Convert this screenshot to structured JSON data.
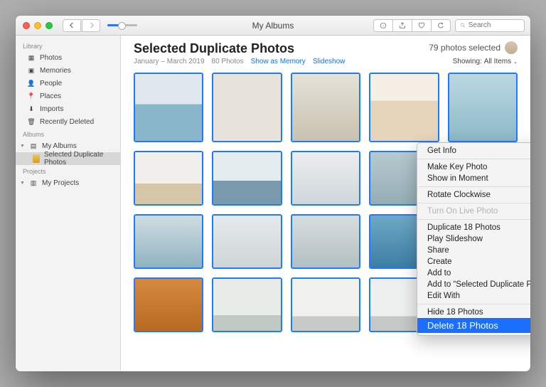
{
  "titlebar": {
    "title": "My Albums"
  },
  "search": {
    "placeholder": "Search"
  },
  "sidebar": {
    "sections": {
      "library": "Library",
      "albums": "Albums",
      "projects": "Projects"
    },
    "library": {
      "photos": "Photos",
      "memories": "Memories",
      "people": "People",
      "places": "Places",
      "imports": "Imports",
      "recently_deleted": "Recently Deleted"
    },
    "albums": {
      "my_albums": "My Albums",
      "selected_duplicate_photos": "Selected Duplicate Photos"
    },
    "projects": {
      "my_projects": "My Projects"
    }
  },
  "header": {
    "title": "Selected Duplicate Photos",
    "selected_count": "79 photos selected"
  },
  "subheader": {
    "date_range": "January – March 2019",
    "photo_count": "80 Photos",
    "show_as_memory": "Show as Memory",
    "slideshow": "Slideshow",
    "showing_label": "Showing:",
    "showing_value": "All Items"
  },
  "context_menu": {
    "get_info": "Get Info",
    "make_key_photo": "Make Key Photo",
    "show_in_moment": "Show in Moment",
    "rotate_clockwise": "Rotate Clockwise",
    "turn_on_live_photo": "Turn On Live Photo",
    "duplicate": "Duplicate 18 Photos",
    "play_slideshow": "Play Slideshow",
    "share": "Share",
    "create": "Create",
    "add_to": "Add to",
    "add_to_album": "Add to “Selected Duplicate Photos”",
    "edit_with": "Edit With",
    "hide": "Hide 18 Photos",
    "delete": "Delete 18 Photos"
  },
  "thumbs": {
    "r0": [
      "linear-gradient(#dfe8ed 0 45%, #8ab6cb 45% 100%)",
      "linear-gradient(#e7e3da 0 100%)",
      "linear-gradient(#e5e2d8,#c8c2b0)",
      "linear-gradient(#f5efe5 0 40%, #e6d5bb 40% 100%)",
      "linear-gradient(#bcd8e1,#8cb9c8)"
    ],
    "r1": [
      "linear-gradient(#f0efec 0 60%, #d6c6a8 60% 100%)",
      "linear-gradient(#e4ecf0 0 55%, #7a9bad 55% 100%)",
      "linear-gradient(#eceff1,#d0d6da)",
      "linear-gradient(#b7c9cf,#95adb5)",
      "linear-gradient(#d3dee2,#a9bec6)"
    ],
    "r2": [
      "linear-gradient(#d0dde1,#8fb3c0)",
      "linear-gradient(#e6eaec,#cfd4d7)",
      "linear-gradient(#d8dedf,#b3bfc3)",
      "linear-gradient(#6ea8c6,#3c7ea3)",
      "linear-gradient(#9fbfd1 0 45%, #e6edf1 45% 60%, #5a839c 60% 100%)"
    ],
    "r3": [
      "linear-gradient(#d68a3f,#b76a20)",
      "linear-gradient(#e8ece9 0 70%, #c0c9c2 70% 100%)",
      "linear-gradient(#f1f2f0 0 72%, #c7cac6 72% 100%)",
      "linear-gradient(#eef0ef 0 72%, #c5c8c6 72% 100%)",
      "linear-gradient(#d6dadc 0 58%, #6f7678 58% 100%)"
    ]
  }
}
